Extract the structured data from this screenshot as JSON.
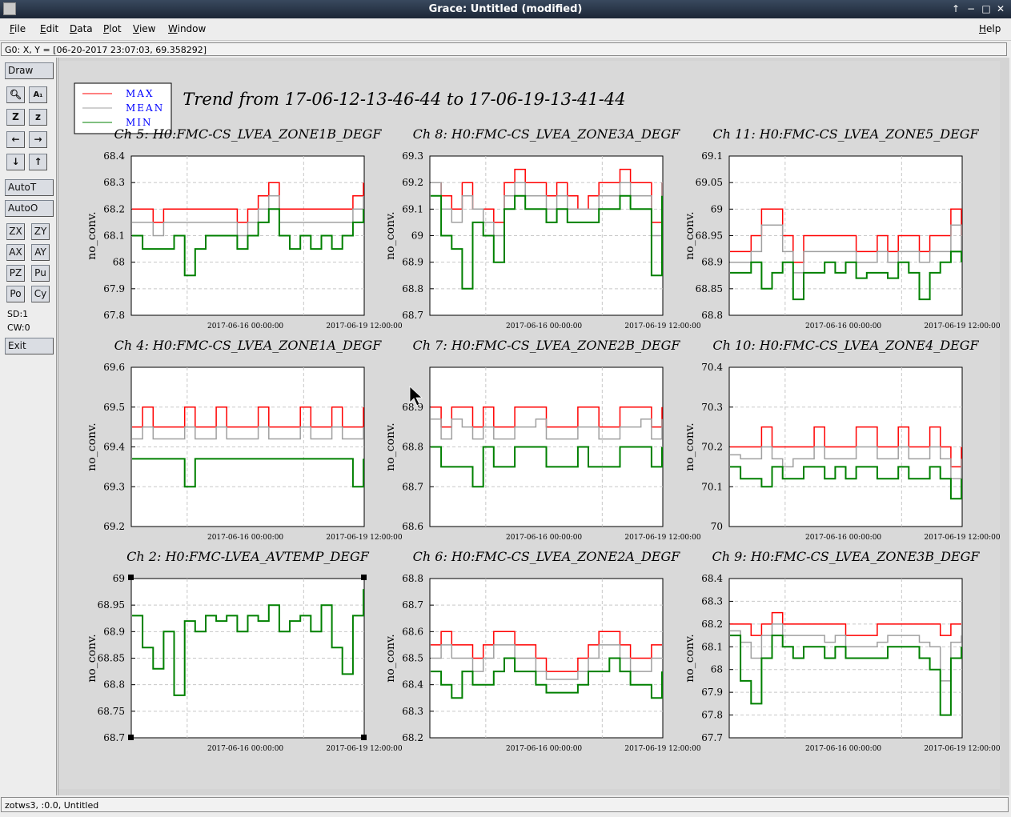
{
  "window": {
    "title": "Grace: Untitled (modified)",
    "controls": [
      "↑",
      "−",
      "□",
      "✕"
    ]
  },
  "menu": {
    "items": [
      "File",
      "Edit",
      "Data",
      "Plot",
      "View",
      "Window"
    ],
    "help": "Help"
  },
  "locator": {
    "text": "G0: X, Y = [06-20-2017 23:07:03, 69.358292]"
  },
  "toolbox": {
    "draw": "Draw",
    "icons": [
      [
        "magnifier-icon",
        "text-icon"
      ],
      [
        "zoom-icon",
        "z-icon"
      ],
      [
        "arrow-left-icon",
        "arrow-right-icon"
      ],
      [
        "arrow-down-icon",
        "arrow-up-icon"
      ]
    ],
    "autot": "AutoT",
    "autoo": "AutoO",
    "grid_buttons": [
      [
        "ZX",
        "ZY"
      ],
      [
        "AX",
        "AY"
      ],
      [
        "PZ",
        "Pu"
      ],
      [
        "Po",
        "Cy"
      ]
    ],
    "sd": "SD:1",
    "cw": "CW:0",
    "exit": "Exit"
  },
  "status": {
    "text": "zotws3, :0.0, Untitled"
  },
  "colors": {
    "max": "#ff0000",
    "mean": "#a0a0a0",
    "min": "#008000",
    "legend_text": "#0000ff"
  },
  "chart_data": {
    "title": "Trend from 17-06-12-13-46-44 to 17-06-19-13-41-44",
    "legend": {
      "position": "top-left",
      "entries": [
        "MAX",
        "MEAN",
        "MIN"
      ]
    },
    "x_tick_labels": [
      "2017-06-16 00:00:00",
      "2017-06-19 12:00:00"
    ],
    "panels": [
      {
        "title": "Ch 5: H0:FMC-CS_LVEA_ZONE1B_DEGF",
        "ylabel": "no_conv.",
        "ylim": [
          67.8,
          68.4
        ],
        "yticks": [
          "67.8",
          "67.9",
          "68",
          "68.1",
          "68.2",
          "68.3",
          "68.4"
        ],
        "type": "line",
        "grid": true,
        "series": [
          {
            "name": "MAX",
            "values": [
              68.2,
              68.2,
              68.15,
              68.2,
              68.2,
              68.2,
              68.2,
              68.2,
              68.2,
              68.2,
              68.15,
              68.2,
              68.25,
              68.3,
              68.2,
              68.2,
              68.2,
              68.2,
              68.2,
              68.2,
              68.2,
              68.25,
              68.3
            ]
          },
          {
            "name": "MEAN",
            "values": [
              68.15,
              68.15,
              68.1,
              68.15,
              68.15,
              68.15,
              68.15,
              68.15,
              68.15,
              68.15,
              68.1,
              68.15,
              68.2,
              68.25,
              68.15,
              68.15,
              68.15,
              68.15,
              68.15,
              68.15,
              68.15,
              68.2,
              68.25
            ]
          },
          {
            "name": "MIN",
            "values": [
              68.1,
              68.05,
              68.05,
              68.05,
              68.1,
              67.95,
              68.05,
              68.1,
              68.1,
              68.1,
              68.05,
              68.1,
              68.15,
              68.2,
              68.1,
              68.05,
              68.1,
              68.05,
              68.1,
              68.05,
              68.1,
              68.15,
              68.2
            ]
          }
        ]
      },
      {
        "title": "Ch 8: H0:FMC-CS_LVEA_ZONE3A_DEGF",
        "ylabel": "no_conv.",
        "ylim": [
          68.7,
          69.3
        ],
        "yticks": [
          "68.7",
          "68.8",
          "68.9",
          "69",
          "69.1",
          "69.2",
          "69.3"
        ],
        "type": "line",
        "grid": true,
        "series": [
          {
            "name": "MAX",
            "values": [
              69.2,
              69.15,
              69.1,
              69.2,
              69.1,
              69.1,
              69.05,
              69.2,
              69.25,
              69.2,
              69.2,
              69.15,
              69.2,
              69.15,
              69.1,
              69.15,
              69.2,
              69.2,
              69.25,
              69.2,
              69.2,
              69.05,
              69.2
            ]
          },
          {
            "name": "MEAN",
            "values": [
              69.2,
              69.1,
              69.05,
              69.15,
              69.1,
              69.05,
              69.0,
              69.15,
              69.2,
              69.15,
              69.15,
              69.1,
              69.15,
              69.1,
              69.1,
              69.1,
              69.15,
              69.15,
              69.2,
              69.15,
              69.15,
              69.0,
              69.2
            ]
          },
          {
            "name": "MIN",
            "values": [
              69.15,
              69.0,
              68.95,
              68.8,
              69.05,
              69.0,
              68.9,
              69.1,
              69.15,
              69.1,
              69.1,
              69.05,
              69.1,
              69.05,
              69.05,
              69.05,
              69.1,
              69.1,
              69.15,
              69.1,
              69.1,
              68.85,
              69.15
            ]
          }
        ]
      },
      {
        "title": "Ch 11: H0:FMC-CS_LVEA_ZONE5_DEGF",
        "ylabel": "no_conv.",
        "ylim": [
          68.8,
          69.1
        ],
        "yticks": [
          "68.8",
          "68.85",
          "68.9",
          "68.95",
          "69",
          "69.05",
          "69.1"
        ],
        "type": "line",
        "grid": true,
        "series": [
          {
            "name": "MAX",
            "values": [
              68.92,
              68.92,
              68.95,
              69.0,
              69.0,
              68.95,
              68.9,
              68.95,
              68.95,
              68.95,
              68.95,
              68.95,
              68.92,
              68.92,
              68.95,
              68.92,
              68.95,
              68.95,
              68.92,
              68.95,
              68.95,
              69.0,
              68.95
            ]
          },
          {
            "name": "MEAN",
            "values": [
              68.9,
              68.9,
              68.92,
              68.97,
              68.97,
              68.92,
              68.88,
              68.92,
              68.92,
              68.92,
              68.92,
              68.92,
              68.9,
              68.9,
              68.92,
              68.9,
              68.92,
              68.92,
              68.9,
              68.92,
              68.92,
              68.97,
              68.92
            ]
          },
          {
            "name": "MIN",
            "values": [
              68.88,
              68.88,
              68.9,
              68.85,
              68.88,
              68.9,
              68.83,
              68.88,
              68.88,
              68.9,
              68.88,
              68.9,
              68.87,
              68.88,
              68.88,
              68.87,
              68.9,
              68.88,
              68.83,
              68.88,
              68.9,
              68.92,
              68.9
            ]
          }
        ]
      },
      {
        "title": "Ch 4: H0:FMC-CS_LVEA_ZONE1A_DEGF",
        "ylabel": "no_conv.",
        "ylim": [
          69.2,
          69.6
        ],
        "yticks": [
          "69.2",
          "69.3",
          "69.4",
          "69.5",
          "69.6"
        ],
        "type": "line",
        "grid": true,
        "series": [
          {
            "name": "MAX",
            "values": [
              69.45,
              69.5,
              69.45,
              69.45,
              69.45,
              69.5,
              69.45,
              69.45,
              69.5,
              69.45,
              69.45,
              69.45,
              69.5,
              69.45,
              69.45,
              69.45,
              69.5,
              69.45,
              69.45,
              69.5,
              69.45,
              69.45,
              69.5
            ]
          },
          {
            "name": "MEAN",
            "values": [
              69.42,
              69.45,
              69.42,
              69.42,
              69.42,
              69.45,
              69.42,
              69.42,
              69.45,
              69.42,
              69.42,
              69.42,
              69.45,
              69.42,
              69.42,
              69.42,
              69.45,
              69.42,
              69.42,
              69.45,
              69.42,
              69.42,
              69.45
            ]
          },
          {
            "name": "MIN",
            "values": [
              69.37,
              69.37,
              69.37,
              69.37,
              69.37,
              69.3,
              69.37,
              69.37,
              69.37,
              69.37,
              69.37,
              69.37,
              69.37,
              69.37,
              69.37,
              69.37,
              69.37,
              69.37,
              69.37,
              69.37,
              69.37,
              69.3,
              69.37
            ]
          }
        ]
      },
      {
        "title": "Ch 7: H0:FMC-CS_LVEA_ZONE2B_DEGF",
        "ylabel": "no_conv.",
        "ylim": [
          68.6,
          69.0
        ],
        "yticks": [
          "68.6",
          "68.7",
          "68.8",
          "68.9"
        ],
        "type": "line",
        "grid": true,
        "series": [
          {
            "name": "MAX",
            "values": [
              68.9,
              68.85,
              68.9,
              68.9,
              68.85,
              68.9,
              68.85,
              68.85,
              68.9,
              68.9,
              68.9,
              68.85,
              68.85,
              68.85,
              68.9,
              68.9,
              68.85,
              68.85,
              68.9,
              68.9,
              68.9,
              68.85,
              68.9
            ]
          },
          {
            "name": "MEAN",
            "values": [
              68.87,
              68.82,
              68.87,
              68.85,
              68.82,
              68.85,
              68.82,
              68.82,
              68.85,
              68.85,
              68.87,
              68.82,
              68.82,
              68.82,
              68.85,
              68.85,
              68.82,
              68.82,
              68.85,
              68.85,
              68.87,
              68.82,
              68.87
            ]
          },
          {
            "name": "MIN",
            "values": [
              68.8,
              68.75,
              68.75,
              68.75,
              68.7,
              68.8,
              68.75,
              68.75,
              68.8,
              68.8,
              68.8,
              68.75,
              68.75,
              68.75,
              68.8,
              68.75,
              68.75,
              68.75,
              68.8,
              68.8,
              68.8,
              68.75,
              68.8
            ]
          }
        ]
      },
      {
        "title": "Ch 10: H0:FMC-CS_LVEA_ZONE4_DEGF",
        "ylabel": "no_conv.",
        "ylim": [
          70.0,
          70.4
        ],
        "yticks": [
          "70",
          "70.1",
          "70.2",
          "70.3",
          "70.4"
        ],
        "type": "line",
        "grid": true,
        "series": [
          {
            "name": "MAX",
            "values": [
              70.2,
              70.2,
              70.2,
              70.25,
              70.2,
              70.2,
              70.2,
              70.2,
              70.25,
              70.2,
              70.2,
              70.2,
              70.25,
              70.25,
              70.2,
              70.2,
              70.25,
              70.2,
              70.2,
              70.25,
              70.2,
              70.15,
              70.2
            ]
          },
          {
            "name": "MEAN",
            "values": [
              70.18,
              70.17,
              70.17,
              70.2,
              70.17,
              70.15,
              70.17,
              70.17,
              70.2,
              70.17,
              70.17,
              70.17,
              70.2,
              70.2,
              70.17,
              70.17,
              70.2,
              70.17,
              70.17,
              70.2,
              70.17,
              70.12,
              70.17
            ]
          },
          {
            "name": "MIN",
            "values": [
              70.15,
              70.12,
              70.12,
              70.1,
              70.15,
              70.12,
              70.12,
              70.15,
              70.15,
              70.12,
              70.15,
              70.12,
              70.15,
              70.15,
              70.12,
              70.12,
              70.15,
              70.12,
              70.12,
              70.15,
              70.12,
              70.07,
              70.12
            ]
          }
        ]
      },
      {
        "title": "Ch 2: H0:FMC-LVEA_AVTEMP_DEGF",
        "ylabel": "no_conv.",
        "ylim": [
          68.7,
          69.0
        ],
        "yticks": [
          "68.7",
          "68.75",
          "68.8",
          "68.85",
          "68.9",
          "68.95",
          "69"
        ],
        "type": "line",
        "grid": true,
        "series": [
          {
            "name": "MIN",
            "values": [
              68.93,
              68.87,
              68.83,
              68.9,
              68.78,
              68.92,
              68.9,
              68.93,
              68.92,
              68.93,
              68.9,
              68.93,
              68.92,
              68.95,
              68.9,
              68.92,
              68.93,
              68.9,
              68.95,
              68.87,
              68.82,
              68.93,
              68.98
            ]
          }
        ]
      },
      {
        "title": "Ch 6: H0:FMC-CS_LVEA_ZONE2A_DEGF",
        "ylabel": "no_conv.",
        "ylim": [
          68.2,
          68.8
        ],
        "yticks": [
          "68.2",
          "68.3",
          "68.4",
          "68.5",
          "68.6",
          "68.7",
          "68.8"
        ],
        "type": "line",
        "grid": true,
        "series": [
          {
            "name": "MAX",
            "values": [
              68.55,
              68.6,
              68.55,
              68.55,
              68.5,
              68.55,
              68.6,
              68.6,
              68.55,
              68.55,
              68.5,
              68.45,
              68.45,
              68.45,
              68.5,
              68.55,
              68.6,
              68.6,
              68.55,
              68.5,
              68.5,
              68.55,
              68.55
            ]
          },
          {
            "name": "MEAN",
            "values": [
              68.5,
              68.55,
              68.5,
              68.5,
              68.45,
              68.5,
              68.55,
              68.55,
              68.5,
              68.5,
              68.45,
              68.42,
              68.42,
              68.42,
              68.45,
              68.5,
              68.55,
              68.55,
              68.5,
              68.45,
              68.45,
              68.5,
              68.5
            ]
          },
          {
            "name": "MIN",
            "values": [
              68.45,
              68.4,
              68.35,
              68.45,
              68.4,
              68.4,
              68.45,
              68.5,
              68.45,
              68.45,
              68.4,
              68.37,
              68.37,
              68.37,
              68.4,
              68.45,
              68.45,
              68.5,
              68.45,
              68.4,
              68.4,
              68.35,
              68.45
            ]
          }
        ]
      },
      {
        "title": "Ch 9: H0:FMC-CS_LVEA_ZONE3B_DEGF",
        "ylabel": "no_conv.",
        "ylim": [
          67.7,
          68.4
        ],
        "yticks": [
          "67.7",
          "67.8",
          "67.9",
          "68",
          "68.1",
          "68.2",
          "68.3",
          "68.4"
        ],
        "type": "line",
        "grid": true,
        "series": [
          {
            "name": "MAX",
            "values": [
              68.2,
              68.2,
              68.15,
              68.2,
              68.25,
              68.2,
              68.2,
              68.2,
              68.2,
              68.2,
              68.2,
              68.15,
              68.15,
              68.15,
              68.2,
              68.2,
              68.2,
              68.2,
              68.2,
              68.2,
              68.15,
              68.2,
              68.2
            ]
          },
          {
            "name": "MEAN",
            "values": [
              68.17,
              68.12,
              68.05,
              68.15,
              68.2,
              68.15,
              68.15,
              68.15,
              68.15,
              68.12,
              68.15,
              68.1,
              68.1,
              68.1,
              68.12,
              68.15,
              68.15,
              68.15,
              68.12,
              68.1,
              67.95,
              68.12,
              68.15
            ]
          },
          {
            "name": "MIN",
            "values": [
              68.15,
              67.95,
              67.85,
              68.05,
              68.15,
              68.1,
              68.05,
              68.1,
              68.1,
              68.05,
              68.1,
              68.05,
              68.05,
              68.05,
              68.05,
              68.1,
              68.1,
              68.1,
              68.05,
              68.0,
              67.8,
              68.05,
              68.1
            ]
          }
        ]
      }
    ]
  }
}
